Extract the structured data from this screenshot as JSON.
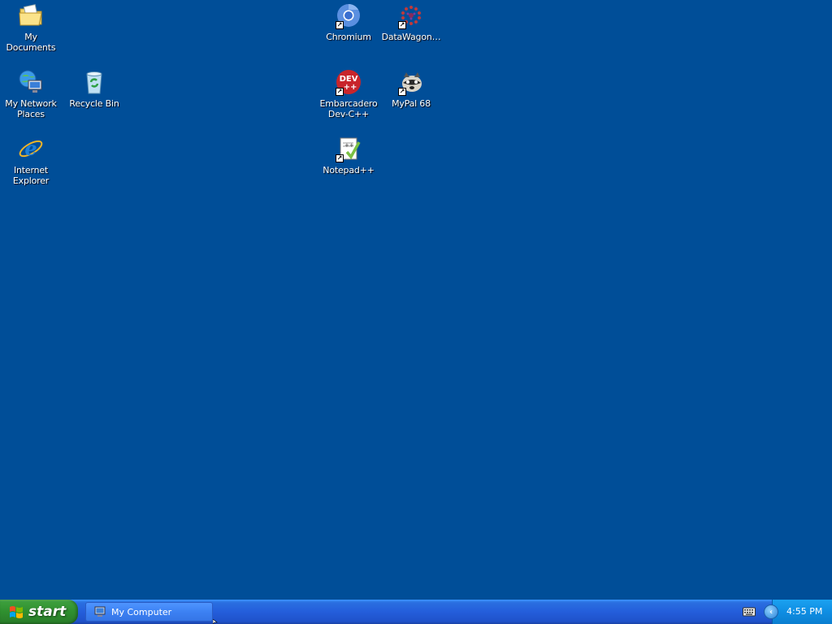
{
  "desktop": {
    "background_color": "#004e98",
    "icons": {
      "my_documents": {
        "label": "My Documents",
        "icon": "folder-documents-icon"
      },
      "my_network_places": {
        "label": "My Network\nPlaces",
        "icon": "network-icon"
      },
      "recycle_bin": {
        "label": "Recycle Bin",
        "icon": "recycle-bin-icon"
      },
      "internet_explorer": {
        "label": "Internet\nExplorer",
        "icon": "internet-explorer-icon"
      },
      "chromium": {
        "label": "Chromium",
        "icon": "chromium-icon"
      },
      "datawagon": {
        "label": "DataWagon…",
        "icon": "datawagon-icon"
      },
      "embarcadero": {
        "label": "Embarcadero\nDev-C++",
        "icon": "devcpp-icon",
        "badge": "DEV\n++"
      },
      "mypal": {
        "label": "MyPal 68",
        "icon": "mypal-icon"
      },
      "notepadpp": {
        "label": "Notepad++",
        "icon": "notepadpp-icon"
      }
    }
  },
  "taskbar": {
    "start_label": "start",
    "tasks": [
      {
        "label": "My Computer",
        "icon": "my-computer-icon"
      }
    ],
    "tray": {
      "clock": "4:55 PM"
    },
    "colors": {
      "taskbar": "#245edb",
      "start": "#3c9e3c",
      "tray": "#0f8ee3"
    }
  }
}
